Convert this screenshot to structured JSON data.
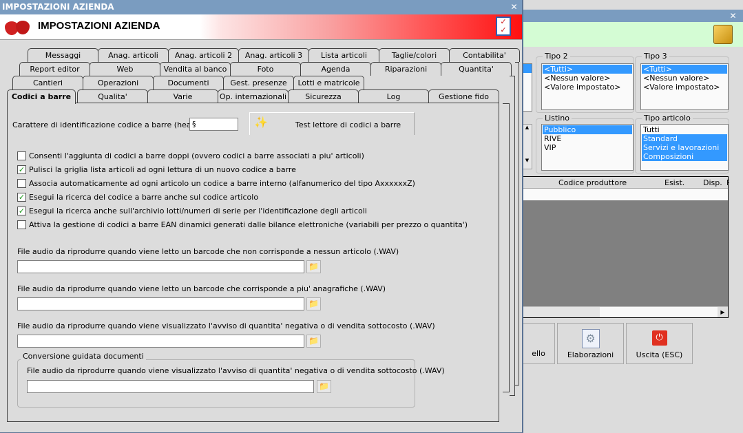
{
  "back_window": {
    "tipo2": {
      "label": "Tipo 2",
      "items": [
        "<Tutti>",
        "<Nessun valore>",
        "<Valore impostato>"
      ],
      "selected": [
        0
      ]
    },
    "tipo3": {
      "label": "Tipo 3",
      "items": [
        "<Tutti>",
        "<Nessun valore>",
        "<Valore impostato>"
      ],
      "selected": [
        0
      ]
    },
    "listino": {
      "label": "Listino",
      "items": [
        "Pubblico",
        "RIVE",
        "VIP"
      ],
      "selected": [
        0
      ]
    },
    "tipo_articolo": {
      "label": "Tipo articolo",
      "items": [
        "Tutti",
        "Standard",
        "Servizi e lavorazioni",
        "Composizioni"
      ],
      "selected": [
        1,
        2,
        3
      ]
    },
    "grid_columns": [
      "Codice produttore",
      "Esist.",
      "Disp.",
      "P"
    ],
    "buttons": {
      "partial": "ello",
      "elaborazioni": "Elaborazioni",
      "uscita": "Uscita (ESC)"
    },
    "icons": [
      "box-icon",
      "gear-document-icon",
      "power-icon"
    ]
  },
  "dialog": {
    "title": "IMPOSTAZIONI AZIENDA",
    "header_title": "IMPOSTAZIONI AZIENDA",
    "accent": "#ff1010",
    "tab_rows": [
      [
        "Messaggi",
        "Anag. articoli",
        "Anag. articoli 2",
        "Anag. articoli 3",
        "Lista articoli",
        "Taglie/colori",
        "Contabilita'"
      ],
      [
        "Report editor",
        "Web",
        "Vendita al banco",
        "Foto",
        "Agenda",
        "Riparazioni",
        "Quantita'"
      ],
      [
        "Cantieri",
        "Operazioni",
        "Documenti",
        "Gest. presenze",
        "Lotti e matricole"
      ],
      [
        "Codici a barre",
        "Qualita'",
        "Varie",
        "Op. internazionali",
        "Sicurezza",
        "Log",
        "Gestione fido"
      ]
    ],
    "active_tab": "Codici a barre",
    "header_char_label": "Carattere di identificazione codice a barre (header) :",
    "header_char_value": "§",
    "test_button": "Test lettore di codici a barre",
    "checkboxes": [
      {
        "label": "Consenti l'aggiunta di codici a barre doppi (ovvero codici a barre associati a piu' articoli)",
        "checked": false
      },
      {
        "label": "Pulisci la griglia lista articoli ad ogni lettura di un nuovo codice a barre",
        "checked": true
      },
      {
        "label": "Associa automaticamente ad ogni articolo un codice a barre interno (alfanumerico del tipo AxxxxxxZ)",
        "checked": false
      },
      {
        "label": "Esegui la ricerca del codice a barre anche sul codice articolo",
        "checked": true
      },
      {
        "label": "Esegui la ricerca anche sull'archivio lotti/numeri di serie per l'identificazione degli articoli",
        "checked": true
      },
      {
        "label": "Attiva la gestione di codici a barre EAN dinamici generati dalle bilance elettroniche (variabili per prezzo o quantita')",
        "checked": false
      }
    ],
    "audio_files": [
      {
        "label": "File audio da riprodurre quando viene letto un barcode che non corrisponde a nessun articolo (.WAV)",
        "value": ""
      },
      {
        "label": "File audio da riprodurre quando viene letto un barcode che corrisponde a piu' anagrafiche (.WAV)",
        "value": ""
      },
      {
        "label": "File audio da riprodurre quando viene visualizzato l'avviso di quantita' negativa o di vendita sottocosto (.WAV)",
        "value": ""
      }
    ],
    "conversion_group": {
      "label": "Conversione guidata documenti",
      "file_label": "File audio da riprodurre quando viene visualizzato l'avviso di quantita' negativa o di vendita sottocosto (.WAV)",
      "value": ""
    }
  }
}
